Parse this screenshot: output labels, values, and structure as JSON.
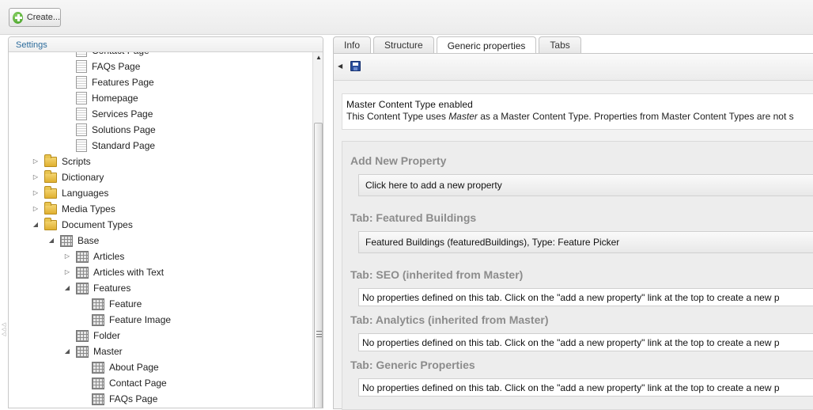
{
  "toolbar": {
    "create_label": "Create..."
  },
  "tree": {
    "header": "Settings",
    "nodes": [
      {
        "label": "Contact Page",
        "icon": "document-icon",
        "expander": ""
      },
      {
        "label": "FAQs Page",
        "icon": "document-icon",
        "expander": ""
      },
      {
        "label": "Features Page",
        "icon": "document-icon",
        "expander": ""
      },
      {
        "label": "Homepage",
        "icon": "document-icon",
        "expander": ""
      },
      {
        "label": "Services Page",
        "icon": "document-icon",
        "expander": ""
      },
      {
        "label": "Solutions Page",
        "icon": "document-icon",
        "expander": ""
      },
      {
        "label": "Standard Page",
        "icon": "document-icon",
        "expander": ""
      },
      {
        "label": "Scripts",
        "icon": "folder-icon",
        "expander": "collapsed"
      },
      {
        "label": "Dictionary",
        "icon": "folder-icon",
        "expander": "collapsed"
      },
      {
        "label": "Languages",
        "icon": "folder-icon",
        "expander": "collapsed"
      },
      {
        "label": "Media Types",
        "icon": "folder-icon",
        "expander": "collapsed"
      },
      {
        "label": "Document Types",
        "icon": "folder-icon",
        "expander": "expanded"
      },
      {
        "label": "Base",
        "icon": "doctype-icon",
        "expander": "expanded"
      },
      {
        "label": "Articles",
        "icon": "doctype-icon",
        "expander": "collapsed"
      },
      {
        "label": "Articles with Text",
        "icon": "doctype-icon",
        "expander": "collapsed"
      },
      {
        "label": "Features",
        "icon": "doctype-icon",
        "expander": "expanded"
      },
      {
        "label": "Feature",
        "icon": "doctype-icon",
        "expander": ""
      },
      {
        "label": "Feature Image",
        "icon": "doctype-icon",
        "expander": ""
      },
      {
        "label": "Folder",
        "icon": "doctype-icon",
        "expander": ""
      },
      {
        "label": "Master",
        "icon": "doctype-icon",
        "expander": "expanded"
      },
      {
        "label": "About Page",
        "icon": "doctype-icon",
        "expander": ""
      },
      {
        "label": "Contact Page",
        "icon": "doctype-icon",
        "expander": ""
      },
      {
        "label": "FAQs Page",
        "icon": "doctype-icon",
        "expander": ""
      }
    ]
  },
  "tabs": [
    {
      "label": "Info",
      "active": false
    },
    {
      "label": "Structure",
      "active": false
    },
    {
      "label": "Generic properties",
      "active": true
    },
    {
      "label": "Tabs",
      "active": false
    }
  ],
  "master": {
    "title": "Master Content Type enabled",
    "text_before": "This Content Type uses ",
    "master_name": "Master",
    "text_after": " as a Master Content Type. Properties from Master Content Types are not s"
  },
  "properties": {
    "add_title": "Add New Property",
    "add_link": "Click here to add a new property",
    "sections": [
      {
        "title": "Tab: Featured Buildings",
        "item": "Featured Buildings (featuredBuildings), Type: Feature Picker"
      },
      {
        "title": "Tab: SEO (inherited from Master)",
        "empty": "No properties defined on this tab. Click on the \"add a new property\" link at the top to create a new p"
      },
      {
        "title": "Tab: Analytics (inherited from Master)",
        "empty": "No properties defined on this tab. Click on the \"add a new property\" link at the top to create a new p"
      },
      {
        "title": "Tab: Generic Properties",
        "empty": "No properties defined on this tab. Click on the \"add a new property\" link at the top to create a new p"
      }
    ]
  }
}
